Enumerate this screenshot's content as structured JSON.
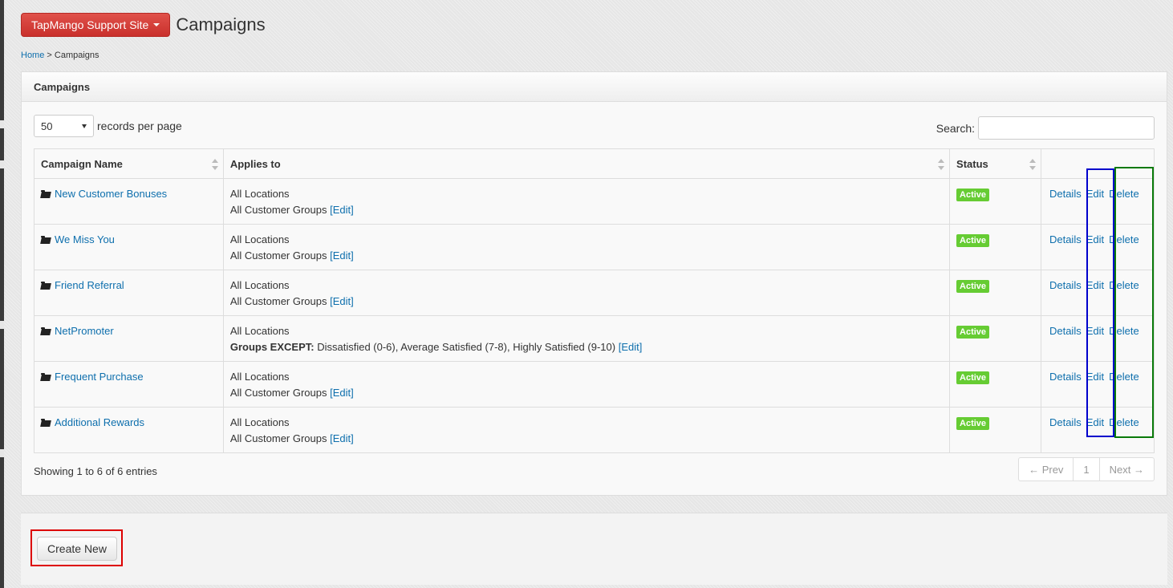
{
  "header": {
    "site_button_label": "TapMango Support Site",
    "page_title": "Campaigns"
  },
  "breadcrumb": {
    "home": "Home",
    "separator": ">",
    "current": "Campaigns"
  },
  "panel": {
    "title": "Campaigns",
    "length_value": "50",
    "length_suffix": "records per page",
    "search_label": "Search:",
    "search_value": ""
  },
  "table": {
    "headers": [
      "Campaign Name",
      "Applies to",
      "Status",
      ""
    ],
    "rows": [
      {
        "name": "New Customer Bonuses",
        "applies_line1": "All Locations",
        "applies_line2": "All Customer Groups",
        "applies_bold": "",
        "edit_link": "[Edit]",
        "status": "Active"
      },
      {
        "name": "We Miss You",
        "applies_line1": "All Locations",
        "applies_line2": "All Customer Groups",
        "applies_bold": "",
        "edit_link": "[Edit]",
        "status": "Active"
      },
      {
        "name": "Friend Referral",
        "applies_line1": "All Locations",
        "applies_line2": "All Customer Groups",
        "applies_bold": "",
        "edit_link": "[Edit]",
        "status": "Active"
      },
      {
        "name": "NetPromoter",
        "applies_line1": "All Locations",
        "applies_line2": "Dissatisfied (0-6), Average Satisfied (7-8), Highly Satisfied (9-10)",
        "applies_bold": "Groups EXCEPT:",
        "edit_link": "[Edit]",
        "status": "Active"
      },
      {
        "name": "Frequent Purchase",
        "applies_line1": "All Locations",
        "applies_line2": "All Customer Groups",
        "applies_bold": "",
        "edit_link": "[Edit]",
        "status": "Active"
      },
      {
        "name": "Additional Rewards",
        "applies_line1": "All Locations",
        "applies_line2": "All Customer Groups",
        "applies_bold": "",
        "edit_link": "[Edit]",
        "status": "Active"
      }
    ],
    "action_labels": {
      "details": "Details",
      "edit": "Edit",
      "delete": "Delete"
    }
  },
  "footer": {
    "info": "Showing 1 to 6 of 6 entries",
    "prev": "← Prev",
    "page": "1",
    "next": "Next →"
  },
  "actions": {
    "create_new": "Create New"
  },
  "colors": {
    "highlight_edit_column": "#0000cc",
    "highlight_delete_column": "#0a7a0a",
    "highlight_create_button": "#dd0000",
    "badge_active": "#66cc33",
    "link": "#0e6fad",
    "site_button": "#d9534f"
  }
}
